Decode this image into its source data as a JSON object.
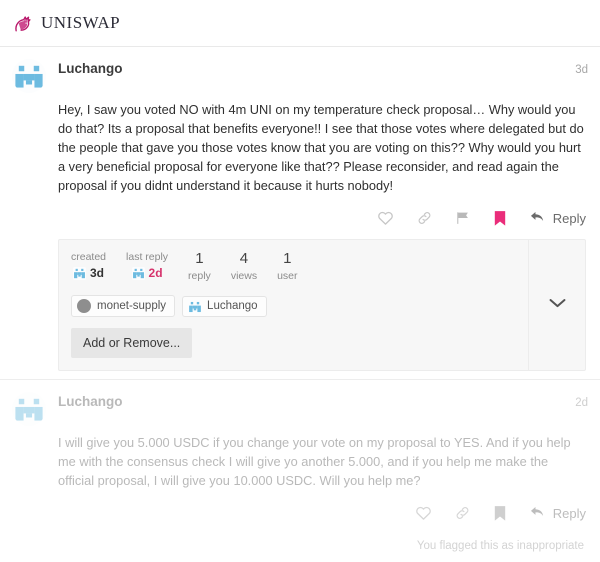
{
  "header": {
    "brand_name": "UNISWAP",
    "logo_icon": "unicorn-icon",
    "brand_color": "#b9186b"
  },
  "posts": [
    {
      "author": "Luchango",
      "timestamp": "3d",
      "avatar_icon": "pixel-identicon-avatar",
      "body": "Hey, I saw you voted NO with 4m UNI on my temperature check proposal… Why would you do that? Its a proposal that benefits everyone!! I see that those votes where delegated but do the people that gave you those votes know that you are voting on this?? Why would you hurt a very beneficial proposal for everyone like that?? Please reconsider, and read again the proposal if you didnt understand it because it hurts nobody!",
      "actions": {
        "like_icon": "heart-icon",
        "share_icon": "link-icon",
        "flag_icon": "flag-icon",
        "bookmark_icon": "bookmark-icon",
        "bookmark_active_color": "#ea2d7a",
        "reply_icon": "reply-arrow-icon",
        "reply_label": "Reply"
      }
    },
    {
      "author": "Luchango",
      "timestamp": "2d",
      "avatar_icon": "pixel-identicon-avatar",
      "body": "I will give you 5.000 USDC if you change your vote on my proposal to YES. And if you help me with the consensus check I will give yo another 5.000, and if you help me make the official proposal, I will give you 10.000 USDC. Will you help me?",
      "actions": {
        "like_icon": "heart-icon",
        "share_icon": "link-icon",
        "bookmark_icon": "bookmark-icon",
        "reply_icon": "reply-arrow-icon",
        "reply_label": "Reply"
      },
      "flag_note": "You flagged this as inappropriate"
    }
  ],
  "topic_map": {
    "created": {
      "caption": "created",
      "value": "3d",
      "avatar_icon": "pixel-identicon-avatar"
    },
    "last_reply": {
      "caption": "last reply",
      "value": "2d",
      "avatar_icon": "pixel-identicon-avatar",
      "color": "#d6336c"
    },
    "counters": [
      {
        "number": "1",
        "caption": "reply"
      },
      {
        "number": "4",
        "caption": "views"
      },
      {
        "number": "1",
        "caption": "user"
      }
    ],
    "participants": [
      {
        "name": "monet-supply",
        "avatar_icon": "gray-circle-avatar"
      },
      {
        "name": "Luchango",
        "avatar_icon": "pixel-identicon-avatar"
      }
    ],
    "add_remove_label": "Add or Remove...",
    "toggle_icon": "chevron-down-icon"
  }
}
